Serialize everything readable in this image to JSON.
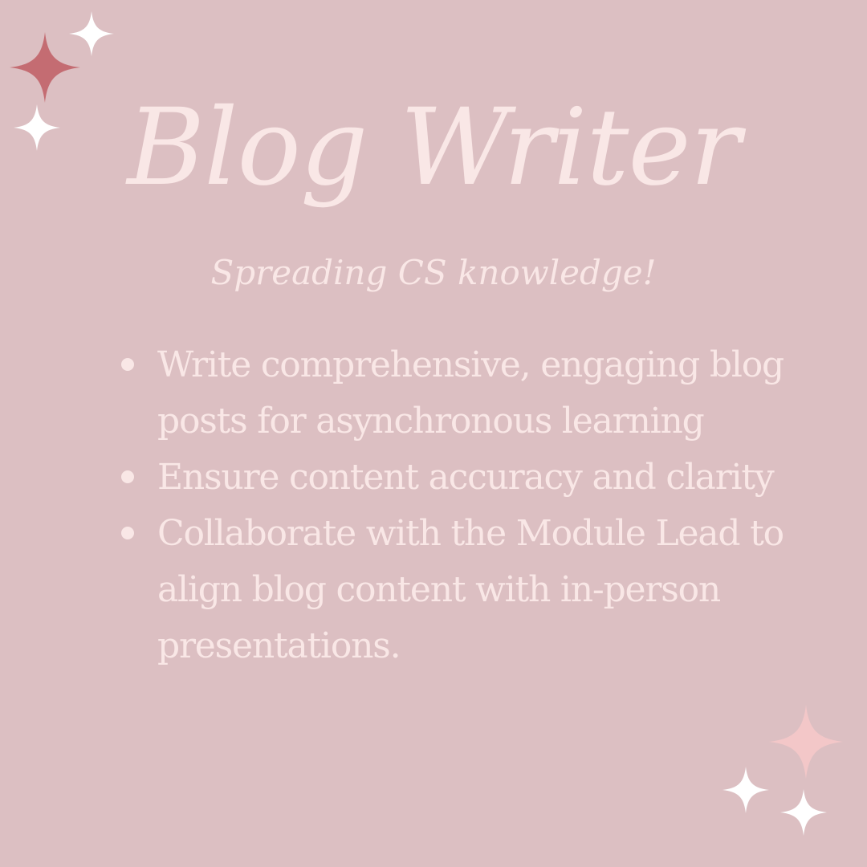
{
  "page": {
    "title": "Blog Writer",
    "subtitle": "Spreading CS knowledge!",
    "bullets": [
      "Write comprehensive, engaging blog posts for asynchronous learning",
      "Ensure content accuracy and clarity",
      "Collaborate with the Module Lead to align blog content with in-person presentations."
    ]
  },
  "colors": {
    "background": "#dcbfc2",
    "text": "#f9e7e6",
    "sparkle_rose": "#c46c72",
    "sparkle_pink": "#f3c7c8",
    "sparkle_white": "#ffffff"
  },
  "decorations": {
    "sparkle_icon": "sparkle-icon"
  }
}
